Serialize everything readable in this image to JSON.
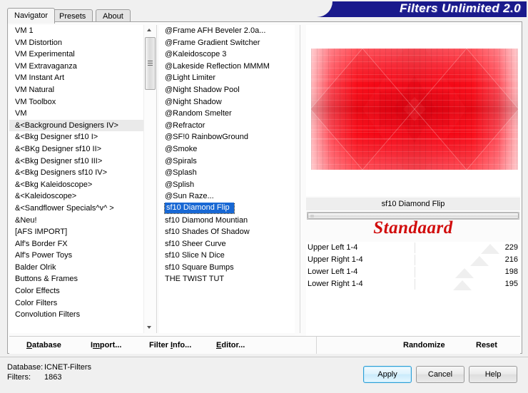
{
  "window": {
    "title": "Filters Unlimited 2.0",
    "banner_color": "#1a1a8c"
  },
  "tabs": [
    {
      "label": "Navigator",
      "active": true
    },
    {
      "label": "Presets",
      "active": false
    },
    {
      "label": "About",
      "active": false
    }
  ],
  "category_list": {
    "items": [
      {
        "label": "VM 1"
      },
      {
        "label": "VM Distortion"
      },
      {
        "label": "VM Experimental"
      },
      {
        "label": "VM Extravaganza"
      },
      {
        "label": "VM Instant Art"
      },
      {
        "label": "VM Natural"
      },
      {
        "label": "VM Toolbox"
      },
      {
        "label": "VM"
      },
      {
        "label": "&<Background Designers IV>",
        "highlighted": true
      },
      {
        "label": "&<Bkg Designer sf10 I>"
      },
      {
        "label": "&<BKg Designer sf10 II>"
      },
      {
        "label": "&<Bkg Designer sf10 III>"
      },
      {
        "label": "&<Bkg Designers sf10 IV>"
      },
      {
        "label": "&<Bkg Kaleidoscope>"
      },
      {
        "label": "&<Kaleidoscope>"
      },
      {
        "label": "&<Sandflower Specials^v^ >"
      },
      {
        "label": "&Neu!"
      },
      {
        "label": "[AFS IMPORT]"
      },
      {
        "label": "Alf's Border FX"
      },
      {
        "label": "Alf's Power Toys"
      },
      {
        "label": "Balder Olrik"
      },
      {
        "label": "Buttons & Frames"
      },
      {
        "label": "Color Effects"
      },
      {
        "label": "Color Filters"
      },
      {
        "label": "Convolution Filters"
      }
    ]
  },
  "filter_list": {
    "items": [
      {
        "label": "@Frame AFH Beveler 2.0a..."
      },
      {
        "label": "@Frame Gradient Switcher"
      },
      {
        "label": "@Kaleidoscope 3"
      },
      {
        "label": "@Lakeside Reflection MMMM"
      },
      {
        "label": "@Light Limiter"
      },
      {
        "label": "@Night Shadow Pool"
      },
      {
        "label": "@Night Shadow"
      },
      {
        "label": "@Random Smelter"
      },
      {
        "label": "@Refractor"
      },
      {
        "label": "@SF!0 RainbowGround"
      },
      {
        "label": "@Smoke"
      },
      {
        "label": "@Spirals"
      },
      {
        "label": "@Splash"
      },
      {
        "label": "@Splish"
      },
      {
        "label": "@Sun Raze..."
      },
      {
        "label": "sf10 Diamond Flip",
        "selected": true
      },
      {
        "label": "sf10 Diamond Mountian"
      },
      {
        "label": "sf10 Shades Of Shadow"
      },
      {
        "label": "sf10 Sheer Curve"
      },
      {
        "label": "sf10 Slice N Dice"
      },
      {
        "label": "sf10 Square Bumps"
      },
      {
        "label": "THE TWIST TUT"
      }
    ]
  },
  "parameters": {
    "filter_name": "sf10 Diamond Flip",
    "preset_name": "Standaard",
    "rows": [
      {
        "label": "Upper Left 1-4",
        "value": "229",
        "pos": 0.86
      },
      {
        "label": "Upper Right 1-4",
        "value": "216",
        "pos": 0.81
      },
      {
        "label": "Lower Left 1-4",
        "value": "198",
        "pos": 0.74
      },
      {
        "label": "Lower Right 1-4",
        "value": "195",
        "pos": 0.73
      }
    ],
    "empty_rows": 5
  },
  "commands": {
    "database": {
      "pre": "",
      "accel": "D",
      "post": "atabase"
    },
    "import": {
      "pre": "I",
      "accel": "m",
      "post": "port..."
    },
    "filter_info": {
      "pre": "Filter ",
      "accel": "I",
      "post": "nfo..."
    },
    "editor": {
      "pre": "",
      "accel": "E",
      "post": "ditor..."
    },
    "randomize": "Randomize",
    "reset": "Reset"
  },
  "status": {
    "database_label": "Database:",
    "database_value": "ICNET-Filters",
    "filters_label": "Filters:",
    "filters_value": "1863"
  },
  "dialog_buttons": {
    "apply": "Apply",
    "cancel": "Cancel",
    "help": "Help"
  }
}
